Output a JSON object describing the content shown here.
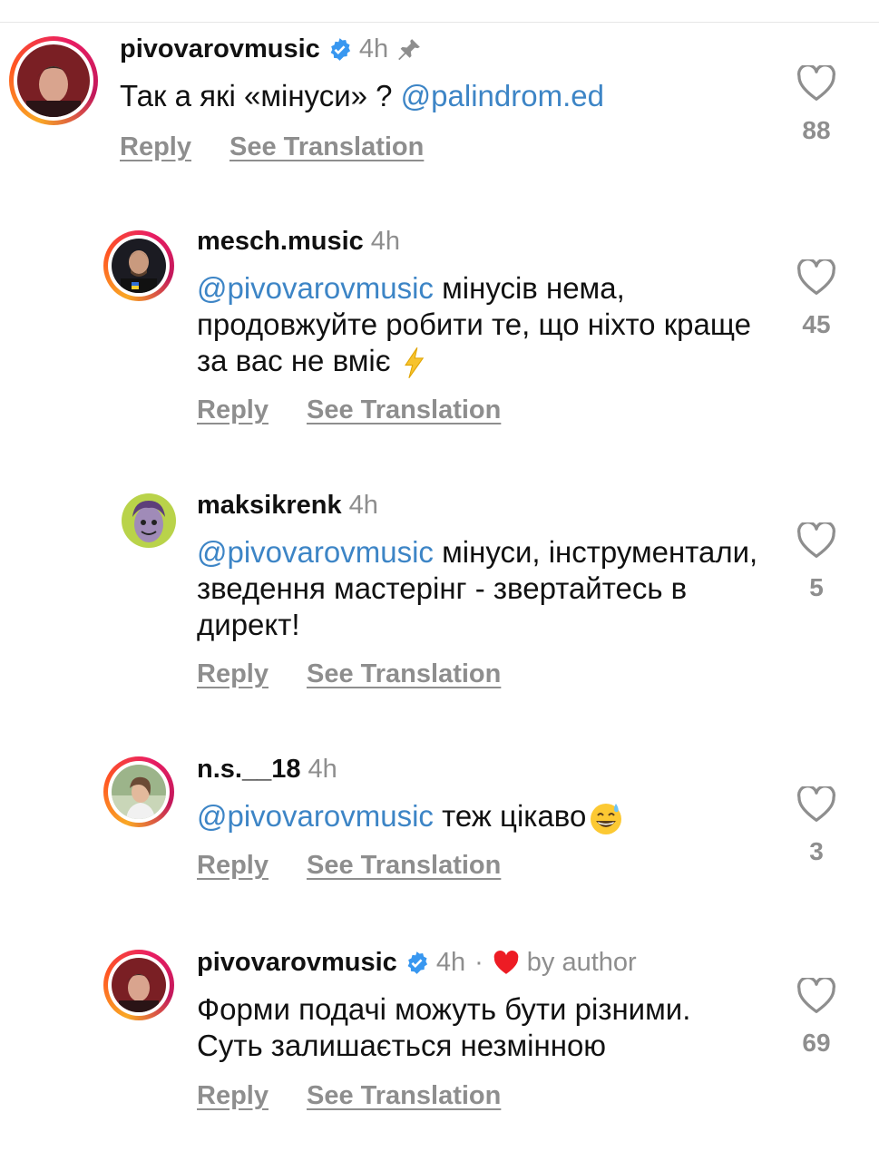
{
  "comments": [
    {
      "username": "pivovarovmusic",
      "verified": true,
      "time": "4h",
      "pinned": true,
      "liked_by_author": false,
      "text_parts": [
        {
          "text": "Так а які «мінуси» ? "
        },
        {
          "mention": "@palindrom.ed"
        }
      ],
      "reply_label": "Reply",
      "translate_label": "See Translation",
      "likes": "88"
    },
    {
      "username": "mesch.music",
      "verified": false,
      "time": "4h",
      "mention": "@pivovarovmusic",
      "text": " мінусів нема, продовжуйте робити те, що ніхто краще за вас не вміє ",
      "emoji": "high-voltage-emoji",
      "reply_label": "Reply",
      "translate_label": "See Translation",
      "likes": "45"
    },
    {
      "username": "maksikrenk",
      "verified": false,
      "time": "4h",
      "mention": "@pivovarovmusic",
      "text": " мінуси, інструментали, зведення мастерінг - звертайтесь в директ!",
      "reply_label": "Reply",
      "translate_label": "See Translation",
      "likes": "5"
    },
    {
      "username": "n.s.__18",
      "verified": false,
      "time": "4h",
      "mention": "@pivovarovmusic",
      "text": " теж цікаво",
      "emoji": "grinning-sweat-emoji",
      "reply_label": "Reply",
      "translate_label": "See Translation",
      "likes": "3"
    },
    {
      "username": "pivovarovmusic",
      "verified": true,
      "time": "4h",
      "separator": "·",
      "liked_by_author": true,
      "liked_by_author_label": "by author",
      "text": "Форми подачі можуть бути різними. Суть залишається незмінною",
      "reply_label": "Reply",
      "translate_label": "See Translation",
      "likes": "69"
    }
  ],
  "colors": {
    "mention": "#3d85c6",
    "muted": "#8e8e8e",
    "verified": "#3897f0",
    "author_heart": "#ed1c24"
  },
  "icons": [
    "verified-badge-icon",
    "pin-icon",
    "heart-outline-icon",
    "heart-filled-icon"
  ]
}
